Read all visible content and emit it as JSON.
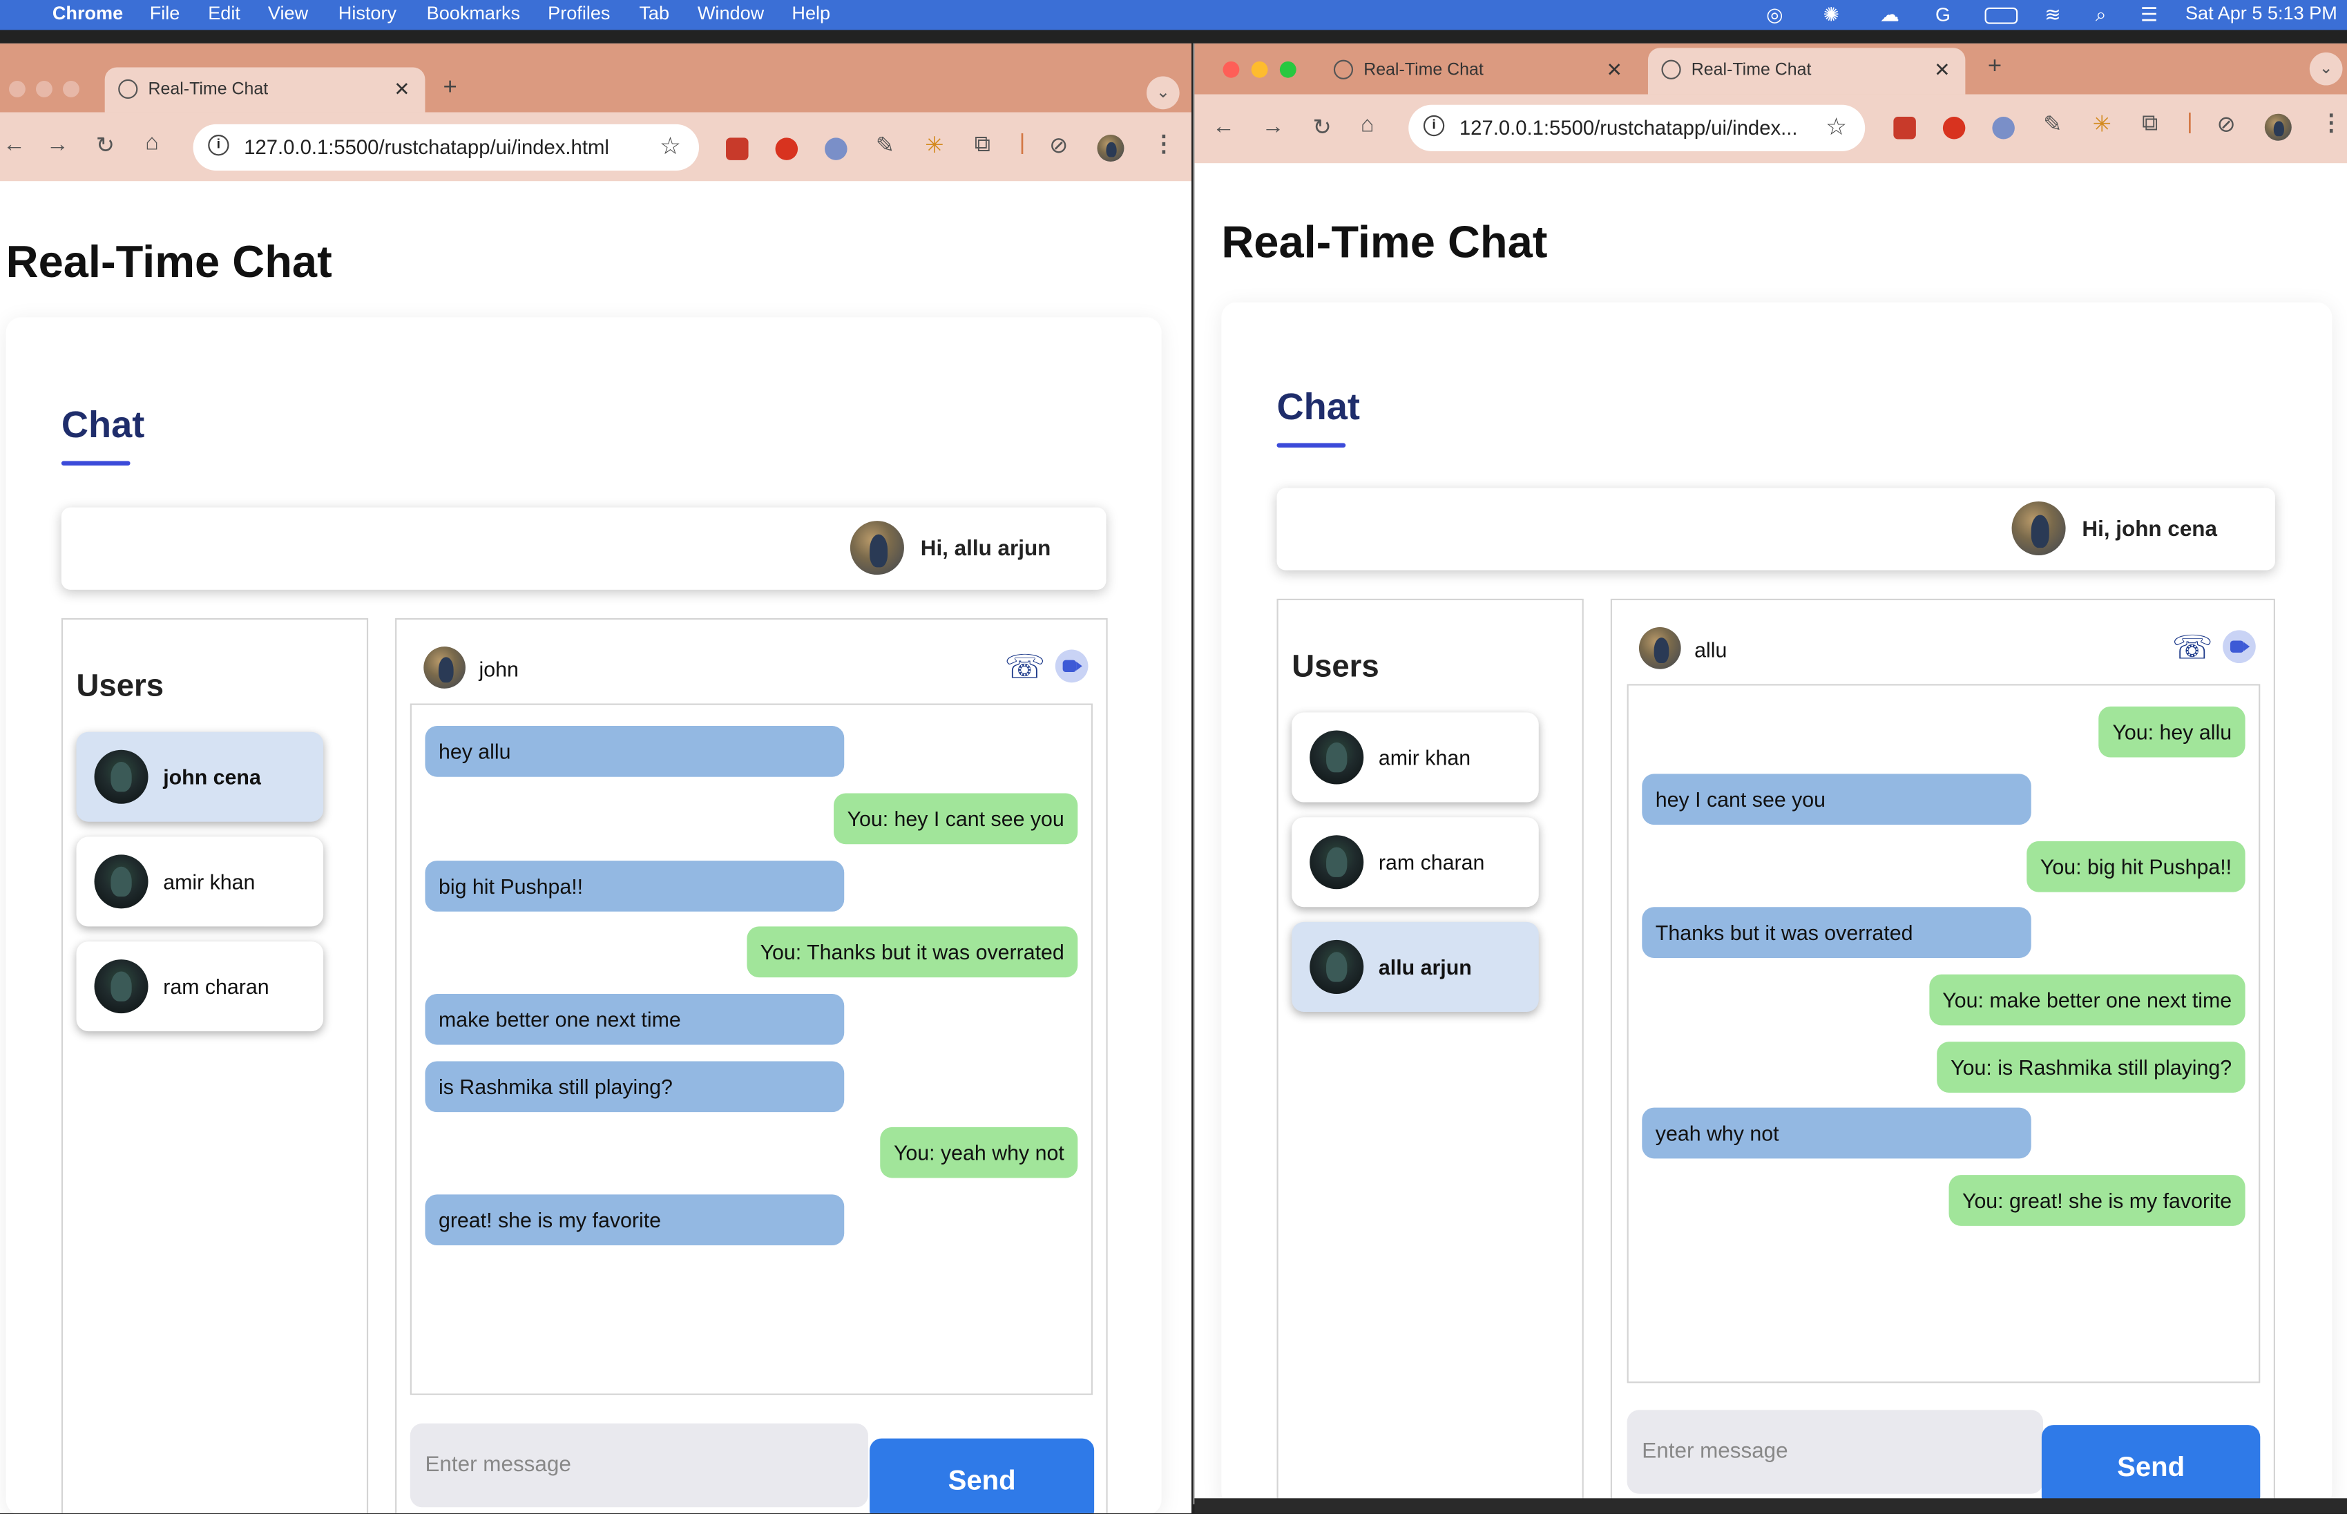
{
  "menubar": {
    "app": "Chrome",
    "items": [
      "File",
      "Edit",
      "View",
      "History",
      "Bookmarks",
      "Profiles",
      "Tab",
      "Window",
      "Help"
    ],
    "clock": "Sat Apr 5  5:13 PM"
  },
  "left": {
    "tab_title": "Real-Time Chat",
    "url": "127.0.0.1:5500/rustchatapp/ui/index.html",
    "heading": "Real-Time Chat",
    "chat_heading": "Chat",
    "greeting": "Hi, allu arjun",
    "users_heading": "Users",
    "users": [
      {
        "name": "john cena",
        "selected": true
      },
      {
        "name": "amir khan",
        "selected": false
      },
      {
        "name": "ram charan",
        "selected": false
      }
    ],
    "chat_with": "john",
    "messages": [
      {
        "text": "hey allu",
        "dir": "in"
      },
      {
        "text": "You: hey I cant see you",
        "dir": "out"
      },
      {
        "text": "big hit Pushpa!!",
        "dir": "in"
      },
      {
        "text": "You: Thanks but it was overrated",
        "dir": "out"
      },
      {
        "text": "make better one next time",
        "dir": "in"
      },
      {
        "text": "is Rashmika still playing?",
        "dir": "in"
      },
      {
        "text": "You: yeah why not",
        "dir": "out"
      },
      {
        "text": "great! she is my favorite",
        "dir": "in"
      }
    ],
    "placeholder": "Enter message",
    "send": "Send"
  },
  "right": {
    "tabs": [
      "Real-Time Chat",
      "Real-Time Chat"
    ],
    "url": "127.0.0.1:5500/rustchatapp/ui/index...",
    "heading": "Real-Time Chat",
    "chat_heading": "Chat",
    "greeting": "Hi, john cena",
    "users_heading": "Users",
    "users": [
      {
        "name": "amir khan",
        "selected": false
      },
      {
        "name": "ram charan",
        "selected": false
      },
      {
        "name": "allu arjun",
        "selected": true
      }
    ],
    "chat_with": "allu",
    "messages": [
      {
        "text": "You: hey allu",
        "dir": "out"
      },
      {
        "text": "hey I cant see you",
        "dir": "in"
      },
      {
        "text": "You: big hit Pushpa!!",
        "dir": "out"
      },
      {
        "text": "Thanks but it was overrated",
        "dir": "in"
      },
      {
        "text": "You: make better one next time",
        "dir": "out"
      },
      {
        "text": "You: is Rashmika still playing?",
        "dir": "out"
      },
      {
        "text": "yeah why not",
        "dir": "in"
      },
      {
        "text": "You: great! she is my favorite",
        "dir": "out"
      }
    ],
    "placeholder": "Enter message",
    "send": "Send"
  },
  "colors": {
    "incoming": "#93b8e2",
    "outgoing": "#a1e59a",
    "send": "#2f7ae8",
    "tabstrip": "#db9a80",
    "accent": "#1f2d6b"
  },
  "icons": [
    "apple-icon",
    "back-icon",
    "forward-icon",
    "reload-icon",
    "home-icon",
    "info-icon",
    "star-icon",
    "phone-icon",
    "video-icon",
    "kebab-icon",
    "close-icon",
    "plus-icon"
  ]
}
